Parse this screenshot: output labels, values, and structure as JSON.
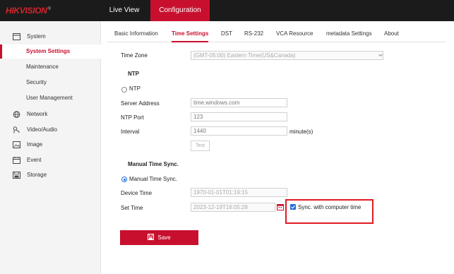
{
  "header": {
    "brand": "HIKVISION",
    "brand_mark": "®",
    "nav": [
      "Live View",
      "Configuration"
    ],
    "active_nav": "Configuration"
  },
  "sidebar": {
    "items": [
      {
        "label": "System",
        "icon": "system-icon"
      },
      {
        "label": "System Settings",
        "sub": true,
        "active": true
      },
      {
        "label": "Maintenance",
        "sub": true
      },
      {
        "label": "Security",
        "sub": true
      },
      {
        "label": "User Management",
        "sub": true
      },
      {
        "label": "Network",
        "icon": "network-icon"
      },
      {
        "label": "Video/Audio",
        "icon": "video-audio-icon"
      },
      {
        "label": "Image",
        "icon": "image-icon"
      },
      {
        "label": "Event",
        "icon": "event-icon"
      },
      {
        "label": "Storage",
        "icon": "storage-icon"
      }
    ]
  },
  "tabs": [
    "Basic Information",
    "Time Settings",
    "DST",
    "RS-232",
    "VCA Resource",
    "metadata Settings",
    "About"
  ],
  "active_tab": "Time Settings",
  "form": {
    "time_zone_label": "Time Zone",
    "time_zone_value": "(GMT-05:00) Eastern Time(US&Canada)",
    "ntp_section": "NTP",
    "ntp_radio_label": "NTP",
    "server_address_label": "Server Address",
    "server_address_value": "time.windows.com",
    "ntp_port_label": "NTP Port",
    "ntp_port_value": "123",
    "interval_label": "Interval",
    "interval_value": "1440",
    "interval_unit": "minute(s)",
    "test_button": "Test",
    "manual_section": "Manual Time Sync.",
    "manual_radio_label": "Manual Time Sync.",
    "device_time_label": "Device Time",
    "device_time_value": "1970-01-01T01:19:15",
    "set_time_label": "Set Time",
    "set_time_value": "2023-12-19T16:05:28",
    "sync_checkbox_label": "Sync. with computer time",
    "sync_checked": true,
    "save_button": "Save"
  },
  "colors": {
    "accent": "#c8102e",
    "topbar": "#1b1b1b",
    "highlight_box": "#e01b24",
    "radio_check": "#1e6fd9"
  }
}
